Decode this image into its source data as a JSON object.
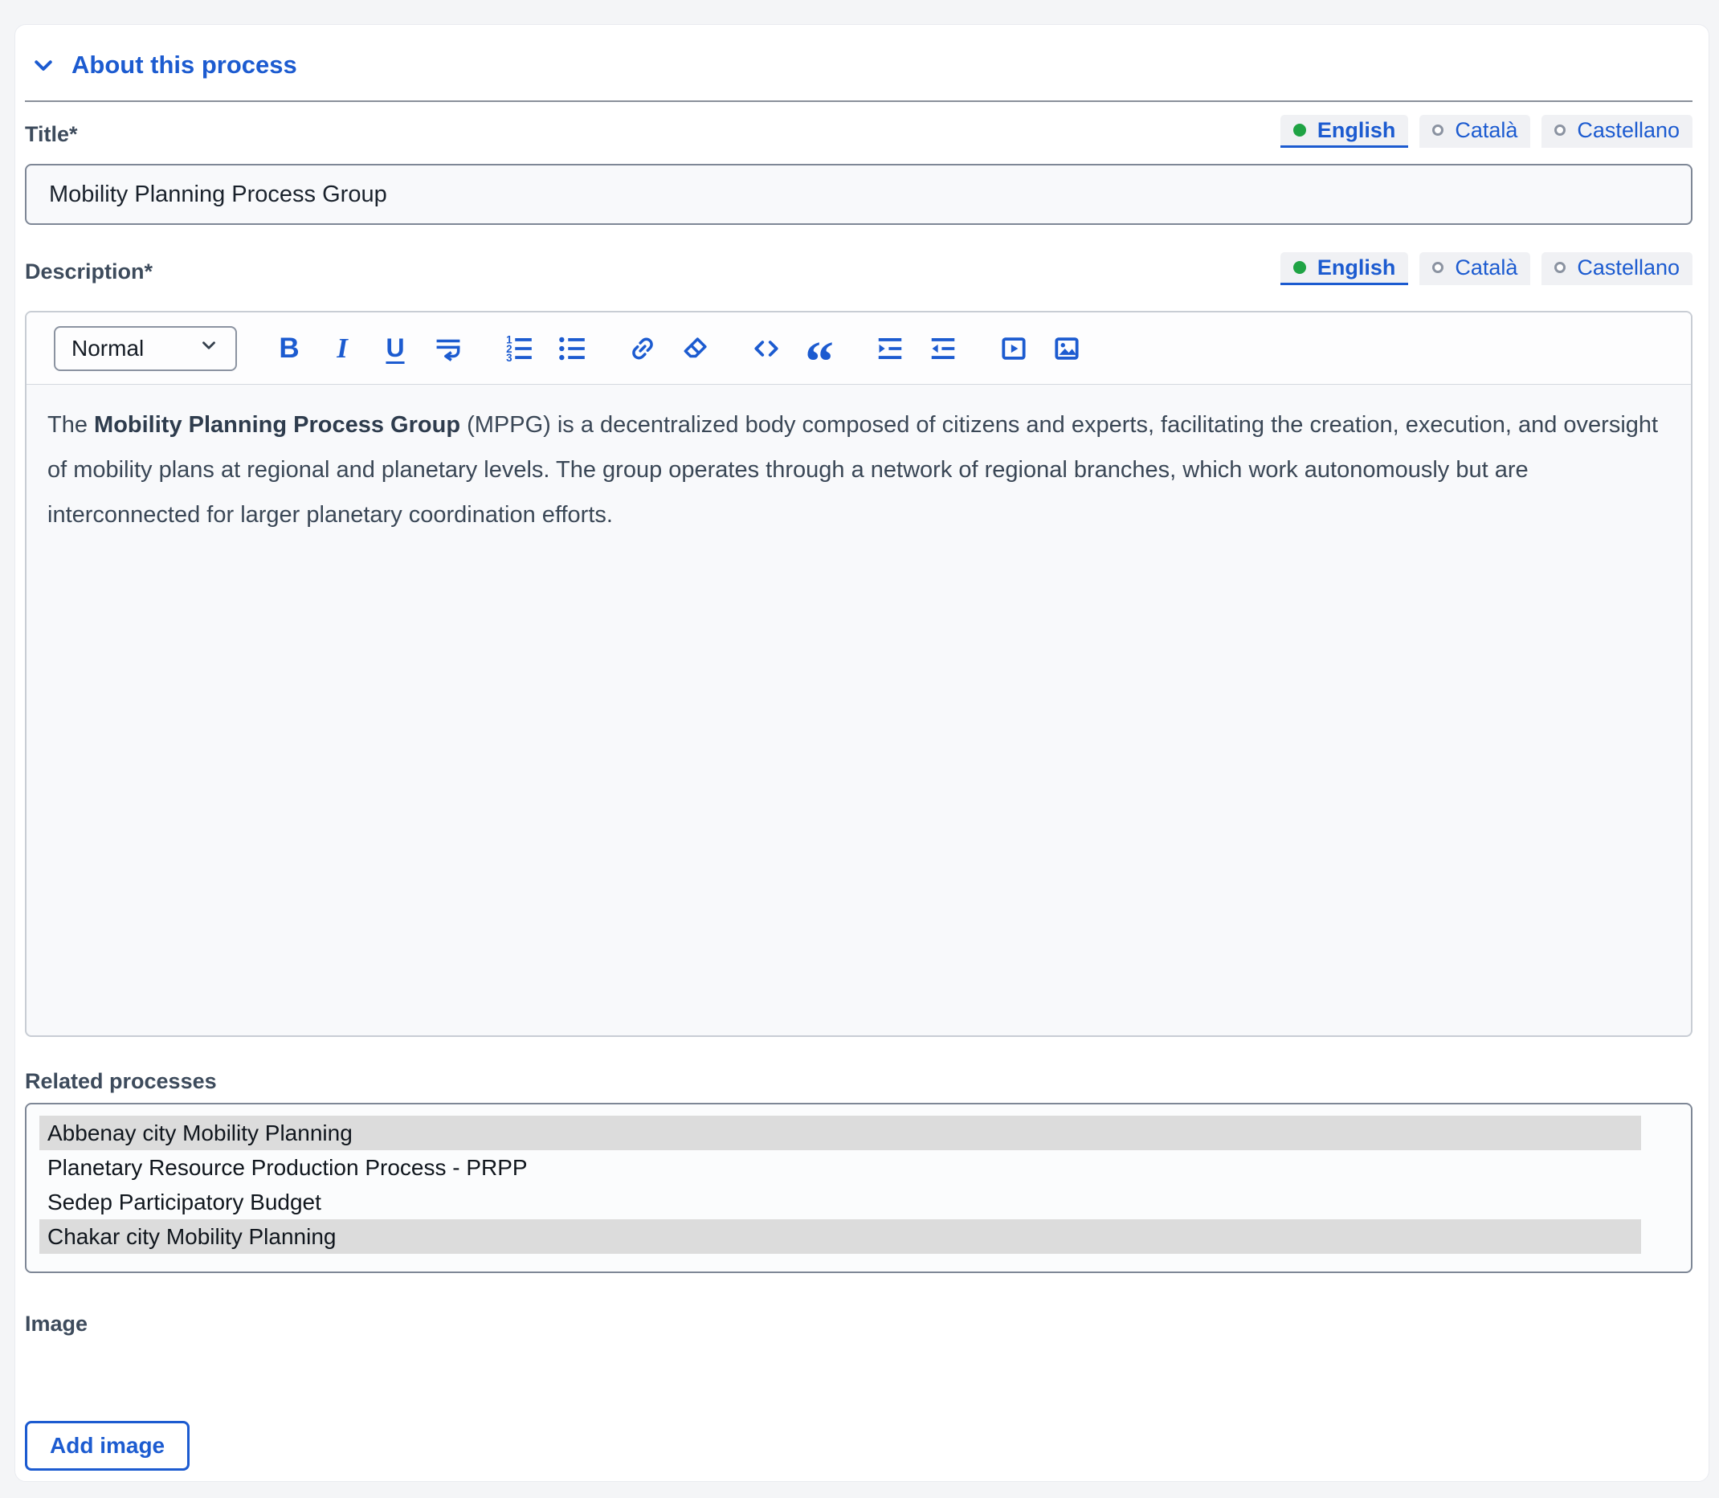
{
  "colors": {
    "accent": "#1c5bd0",
    "active_language_dot": "#1fa344",
    "selected_option_bg": "#dcdcdc"
  },
  "header": {
    "title": "About this process",
    "icon": "chevron-down-icon"
  },
  "language_switcher": {
    "options": [
      {
        "label": "English",
        "active": true
      },
      {
        "label": "Català",
        "active": false
      },
      {
        "label": "Castellano",
        "active": false
      }
    ]
  },
  "title_field": {
    "label": "Title*",
    "value": "Mobility Planning Process Group"
  },
  "description_field": {
    "label": "Description*",
    "toolbar": {
      "style_selector": "Normal",
      "buttons": [
        "bold",
        "italic",
        "underline",
        "line-break",
        "ordered-list",
        "bullet-list",
        "link",
        "clear-format",
        "code-view",
        "blockquote",
        "indent",
        "outdent",
        "video",
        "image"
      ]
    },
    "content": {
      "lead": "The ",
      "bold": "Mobility Planning Process Group",
      "rest": " (MPPG) is a decentralized body composed of citizens and experts, facilitating the creation, execution, and oversight of mobility plans at regional and planetary levels. The group operates through a network of regional branches, which work autonomously but are interconnected for larger planetary coordination efforts."
    }
  },
  "related_processes": {
    "label": "Related processes",
    "options": [
      {
        "label": "Abbenay city Mobility Planning",
        "selected": true
      },
      {
        "label": "Planetary Resource Production Process - PRPP",
        "selected": false
      },
      {
        "label": "Sedep Participatory Budget",
        "selected": false
      },
      {
        "label": "Chakar city Mobility Planning",
        "selected": true
      }
    ]
  },
  "image_field": {
    "label": "Image",
    "add_button": "Add image"
  }
}
